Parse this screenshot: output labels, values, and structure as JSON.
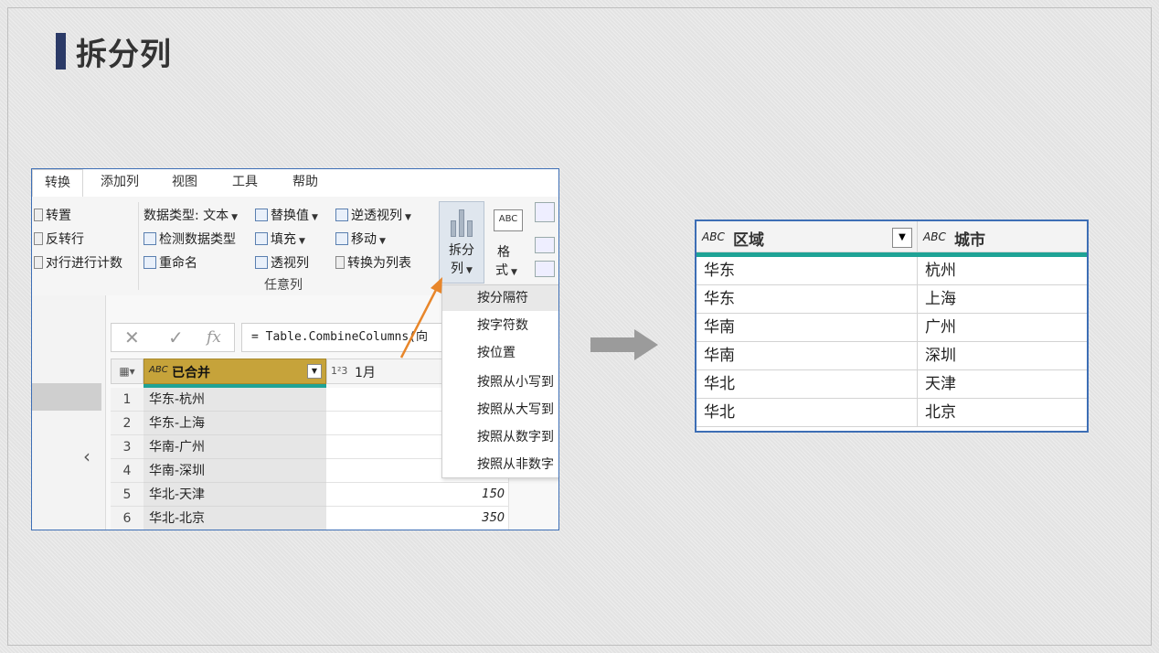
{
  "slide": {
    "title": "拆分列"
  },
  "editor": {
    "tabs": [
      "转换",
      "添加列",
      "视图",
      "工具",
      "帮助"
    ],
    "ribbon": {
      "col1": [
        "转置",
        "反转行",
        "对行进行计数"
      ],
      "data_type": "数据类型: 文本",
      "detect_type": "检测数据类型",
      "rename": "重命名",
      "replace_values": "替换值",
      "fill": "填充",
      "pivot": "透视列",
      "unpivot": "逆透视列",
      "move": "移动",
      "to_list": "转换为列表",
      "group_label": "任意列",
      "split_btn_line1": "拆分",
      "split_btn_line2": "列",
      "format_btn_line1": "格",
      "format_btn_line2": "式",
      "abc_small": "ABC"
    },
    "formula": "= Table.CombineColumns(向",
    "fx_label": "fx",
    "columns": {
      "merged": "已合并",
      "jan": "1月"
    },
    "rows": [
      {
        "num": "1",
        "merged": "华东-杭州",
        "jan": ""
      },
      {
        "num": "2",
        "merged": "华东-上海",
        "jan": ""
      },
      {
        "num": "3",
        "merged": "华南-广州",
        "jan": ""
      },
      {
        "num": "4",
        "merged": "华南-深圳",
        "jan": ""
      },
      {
        "num": "5",
        "merged": "华北-天津",
        "jan": "150"
      },
      {
        "num": "6",
        "merged": "华北-北京",
        "jan": "350"
      }
    ],
    "split_menu": [
      "按分隔符",
      "按字符数",
      "按位置",
      "按照从小写到",
      "按照从大写到",
      "按照从数字到",
      "按照从非数字"
    ]
  },
  "result": {
    "columns": [
      "区域",
      "城市"
    ],
    "rows": [
      [
        "华东",
        "杭州"
      ],
      [
        "华东",
        "上海"
      ],
      [
        "华南",
        "广州"
      ],
      [
        "华南",
        "深圳"
      ],
      [
        "华北",
        "天津"
      ],
      [
        "华北",
        "北京"
      ]
    ]
  }
}
